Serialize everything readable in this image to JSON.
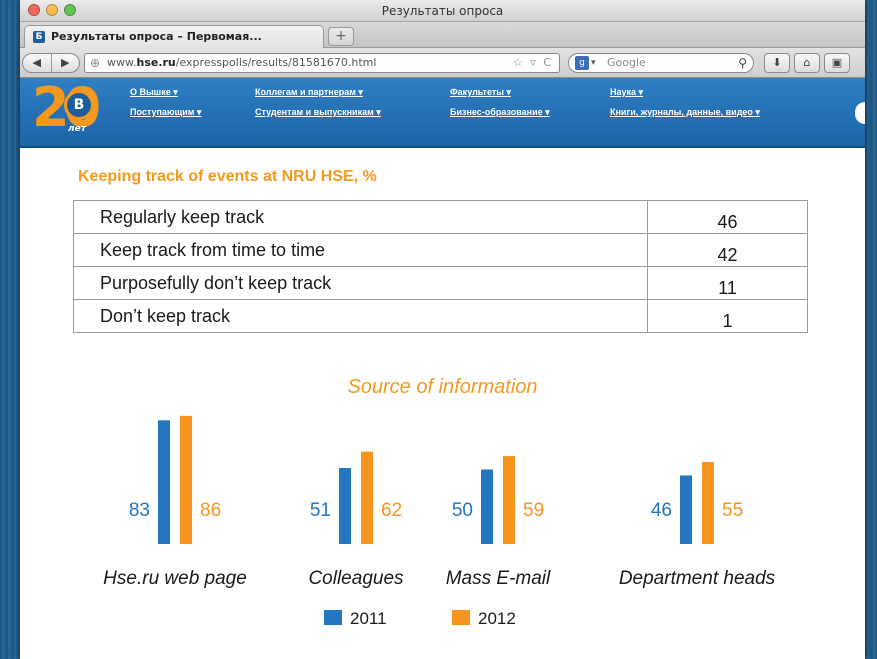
{
  "window": {
    "title": "Результаты опроса"
  },
  "tabs": [
    {
      "label": "Результаты опроса – Первомая..."
    }
  ],
  "toolbar": {
    "new_tab_label": "+",
    "url_prefix": "www.",
    "url_domain": "hse.ru",
    "url_path": "/expresspolls/results/81581670.html",
    "search_placeholder": "Google"
  },
  "site": {
    "logo_number": "20",
    "logo_sub": "лет",
    "nav_row1": [
      "О Вышке ▾",
      "Коллегам и партнерам ▾",
      "Факультеты ▾",
      "Наука ▾"
    ],
    "nav_row2": [
      "Поступающим ▾",
      "Студентам и выпускникам ▾",
      "Бизнес-образование ▾",
      "Книги, журналы, данные, видео ▾"
    ]
  },
  "content": {
    "table_title": "Keeping track of events at NRU HSE, %",
    "table_rows": [
      {
        "label": "Regularly keep track",
        "value": "46"
      },
      {
        "label": "Keep track from time to time",
        "value": "42"
      },
      {
        "label": "Purposefully don’t keep track",
        "value": "11"
      },
      {
        "label": "Don’t keep track",
        "value": "1"
      }
    ]
  },
  "chart_data": {
    "type": "bar",
    "title": "Source of information",
    "categories": [
      "Hse.ru web page",
      "Colleagues",
      "Mass E-mail",
      "Department heads"
    ],
    "series": [
      {
        "name": "2011",
        "values": [
          83,
          51,
          50,
          46
        ],
        "color": "#2476c0"
      },
      {
        "name": "2012",
        "values": [
          86,
          62,
          59,
          55
        ],
        "color": "#f7941d"
      }
    ],
    "legend_position": "bottom",
    "grid": false
  }
}
